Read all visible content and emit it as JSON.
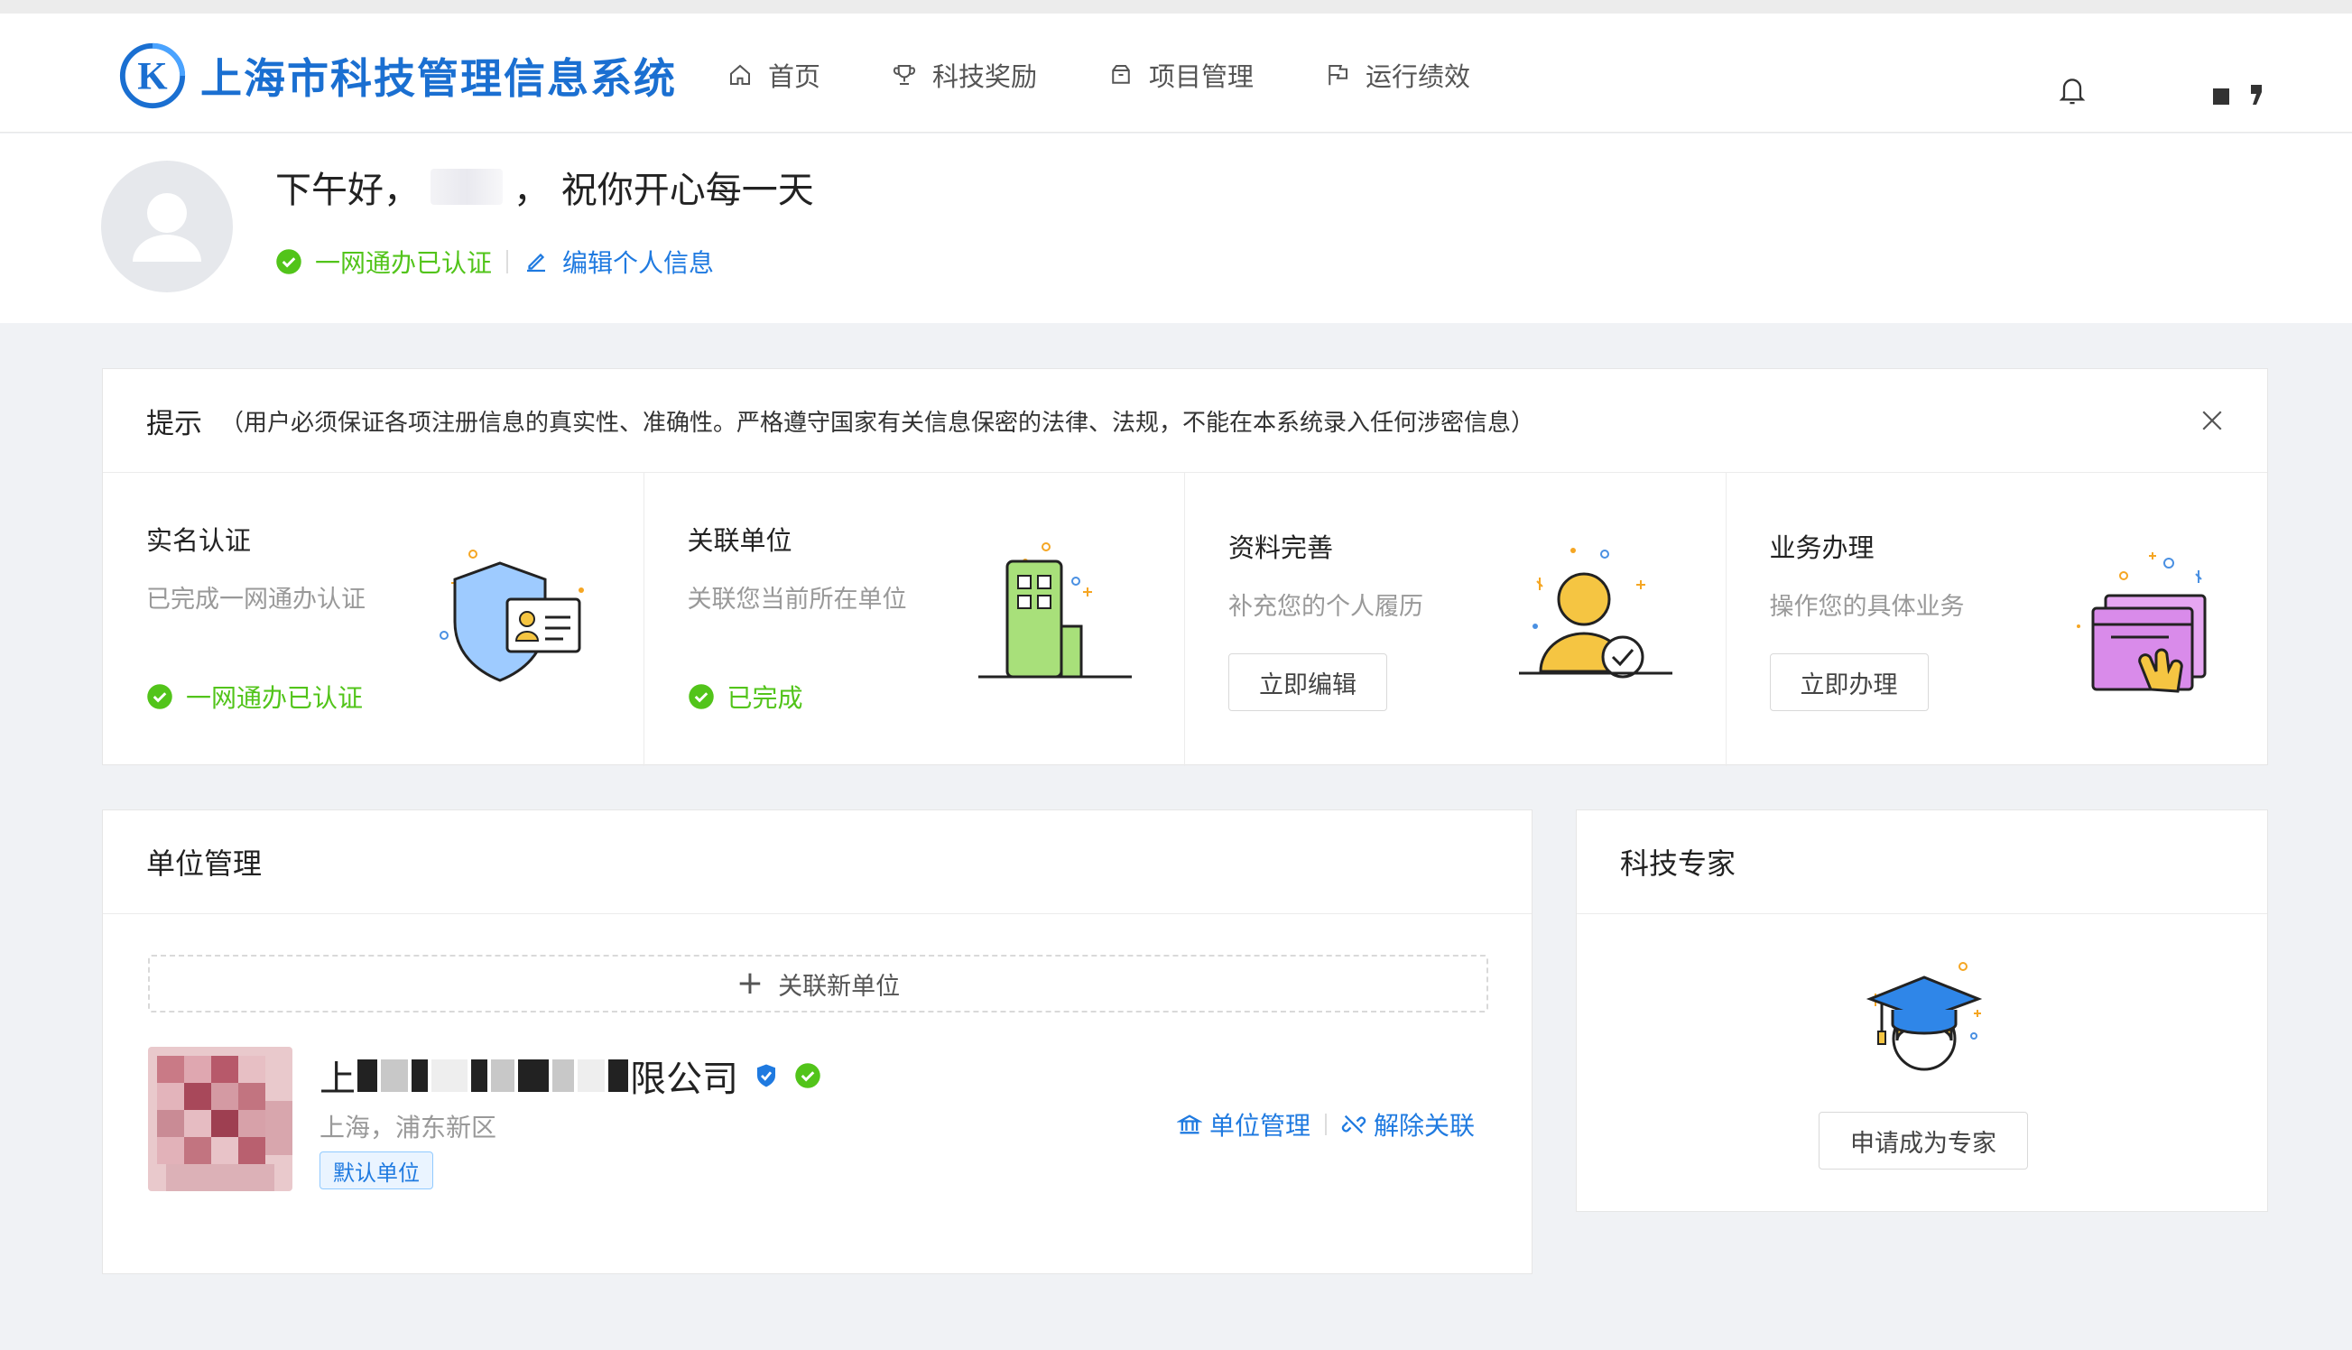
{
  "header": {
    "app_title": "上海市科技管理信息系统",
    "logo_letter": "K",
    "nav": [
      {
        "label": "首页",
        "icon": "home-icon"
      },
      {
        "label": "科技奖励",
        "icon": "trophy-icon"
      },
      {
        "label": "项目管理",
        "icon": "box-icon"
      },
      {
        "label": "运行绩效",
        "icon": "flag-icon"
      }
    ]
  },
  "greeting": {
    "prefix": "下午好，",
    "suffix": "，  祝你开心每一天",
    "certified": "一网通办已认证",
    "edit_profile": "编辑个人信息"
  },
  "tips": {
    "title": "提示",
    "note": "（用户必须保证各项注册信息的真实性、准确性。严格遵守国家有关信息保密的法律、法规，不能在本系统录入任何涉密信息）",
    "items": [
      {
        "title": "实名认证",
        "desc": "已完成一网通办认证",
        "status": "一网通办已认证",
        "icon": "id-shield-icon"
      },
      {
        "title": "关联单位",
        "desc": "关联您当前所在单位",
        "status": "已完成",
        "icon": "building-icon"
      },
      {
        "title": "资料完善",
        "desc": "补充您的个人履历",
        "button": "立即编辑",
        "icon": "user-check-icon"
      },
      {
        "title": "业务办理",
        "desc": "操作您的具体业务",
        "button": "立即办理",
        "icon": "hand-click-icon"
      }
    ]
  },
  "units": {
    "title": "单位管理",
    "add_label": "关联新单位",
    "item": {
      "name_start": "上",
      "name_end": "限公司",
      "location": "上海，浦东新区",
      "tag": "默认单位",
      "manage": "单位管理",
      "unlink": "解除关联"
    }
  },
  "expert": {
    "title": "科技专家",
    "button": "申请成为专家",
    "icon": "graduate-icon"
  },
  "colors": {
    "brand": "#1a6fd1",
    "link": "#1f7ae0",
    "success": "#52c41a",
    "page_bg": "#f0f2f5"
  }
}
